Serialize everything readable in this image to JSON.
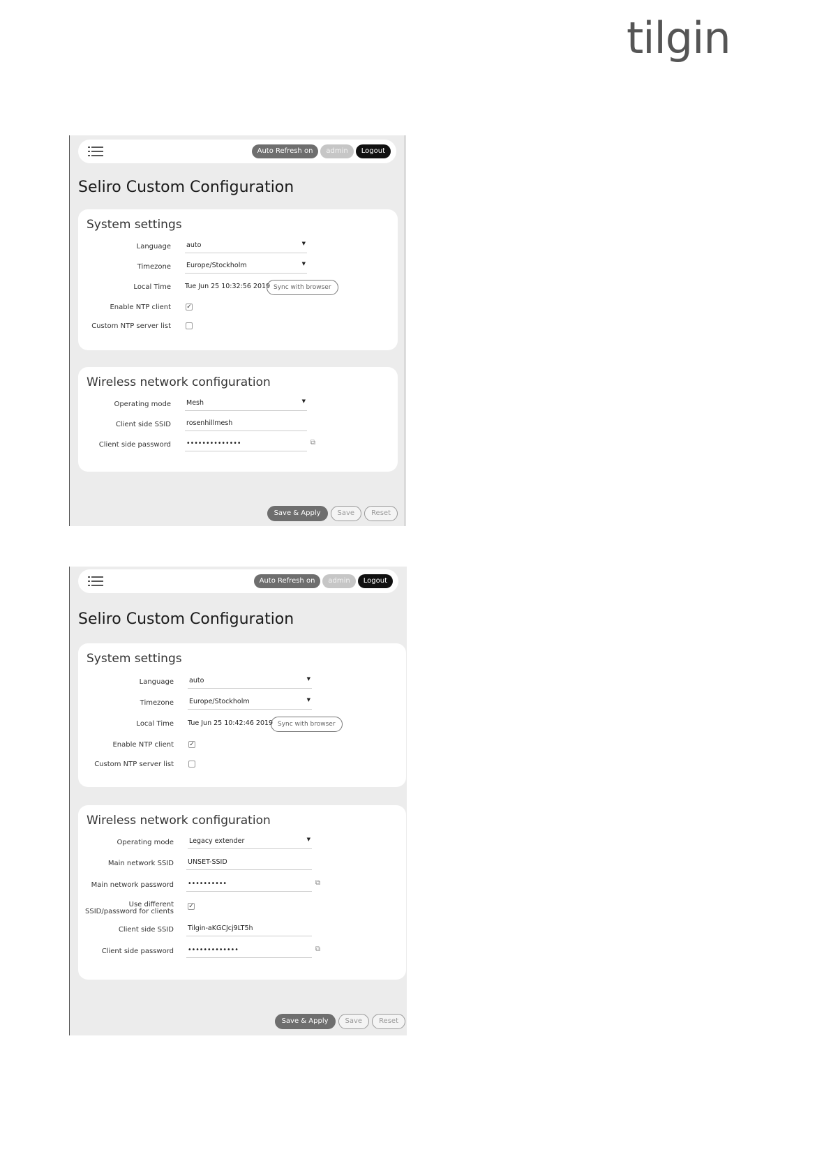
{
  "brand": {
    "logo_text": "tilgin"
  },
  "screens": [
    {
      "topbar": {
        "auto_refresh": "Auto Refresh on",
        "user": "admin",
        "logout": "Logout"
      },
      "title": "Seliro Custom Configuration",
      "system": {
        "heading": "System settings",
        "language_label": "Language",
        "language_value": "auto",
        "timezone_label": "Timezone",
        "timezone_value": "Europe/Stockholm",
        "localtime_label": "Local Time",
        "localtime_value": "Tue Jun 25 10:32:56 2019",
        "sync_button": "Sync with browser",
        "ntp_label": "Enable NTP client",
        "ntp_checked": true,
        "ntp_list_label": "Custom NTP server list",
        "ntp_list_checked": false
      },
      "wireless": {
        "heading": "Wireless network configuration",
        "mode_label": "Operating mode",
        "mode_value": "Mesh",
        "ssid_label": "Client side SSID",
        "ssid_value": "rosenhillmesh",
        "pwd_label": "Client side password",
        "pwd_value": "••••••••••••••"
      },
      "actions": {
        "save_apply": "Save & Apply",
        "save": "Save",
        "reset": "Reset"
      }
    },
    {
      "topbar": {
        "auto_refresh": "Auto Refresh on",
        "user": "admin",
        "logout": "Logout"
      },
      "title": "Seliro Custom Configuration",
      "system": {
        "heading": "System settings",
        "language_label": "Language",
        "language_value": "auto",
        "timezone_label": "Timezone",
        "timezone_value": "Europe/Stockholm",
        "localtime_label": "Local Time",
        "localtime_value": "Tue Jun 25 10:42:46 2019",
        "sync_button": "Sync with browser",
        "ntp_label": "Enable NTP client",
        "ntp_checked": true,
        "ntp_list_label": "Custom NTP server list",
        "ntp_list_checked": false
      },
      "wireless": {
        "heading": "Wireless network configuration",
        "mode_label": "Operating mode",
        "mode_value": "Legacy extender",
        "main_ssid_label": "Main network SSID",
        "main_ssid_value": "UNSET-SSID",
        "main_pwd_label": "Main network password",
        "main_pwd_value": "••••••••••",
        "diff_label_1": "Use different",
        "diff_label_2": "SSID/password for clients",
        "diff_checked": true,
        "ssid_label": "Client side SSID",
        "ssid_value": "Tilgin-aKGCJcj9LT5h",
        "pwd_label": "Client side password",
        "pwd_value": "•••••••••••••"
      },
      "actions": {
        "save_apply": "Save & Apply",
        "save": "Save",
        "reset": "Reset"
      }
    }
  ]
}
